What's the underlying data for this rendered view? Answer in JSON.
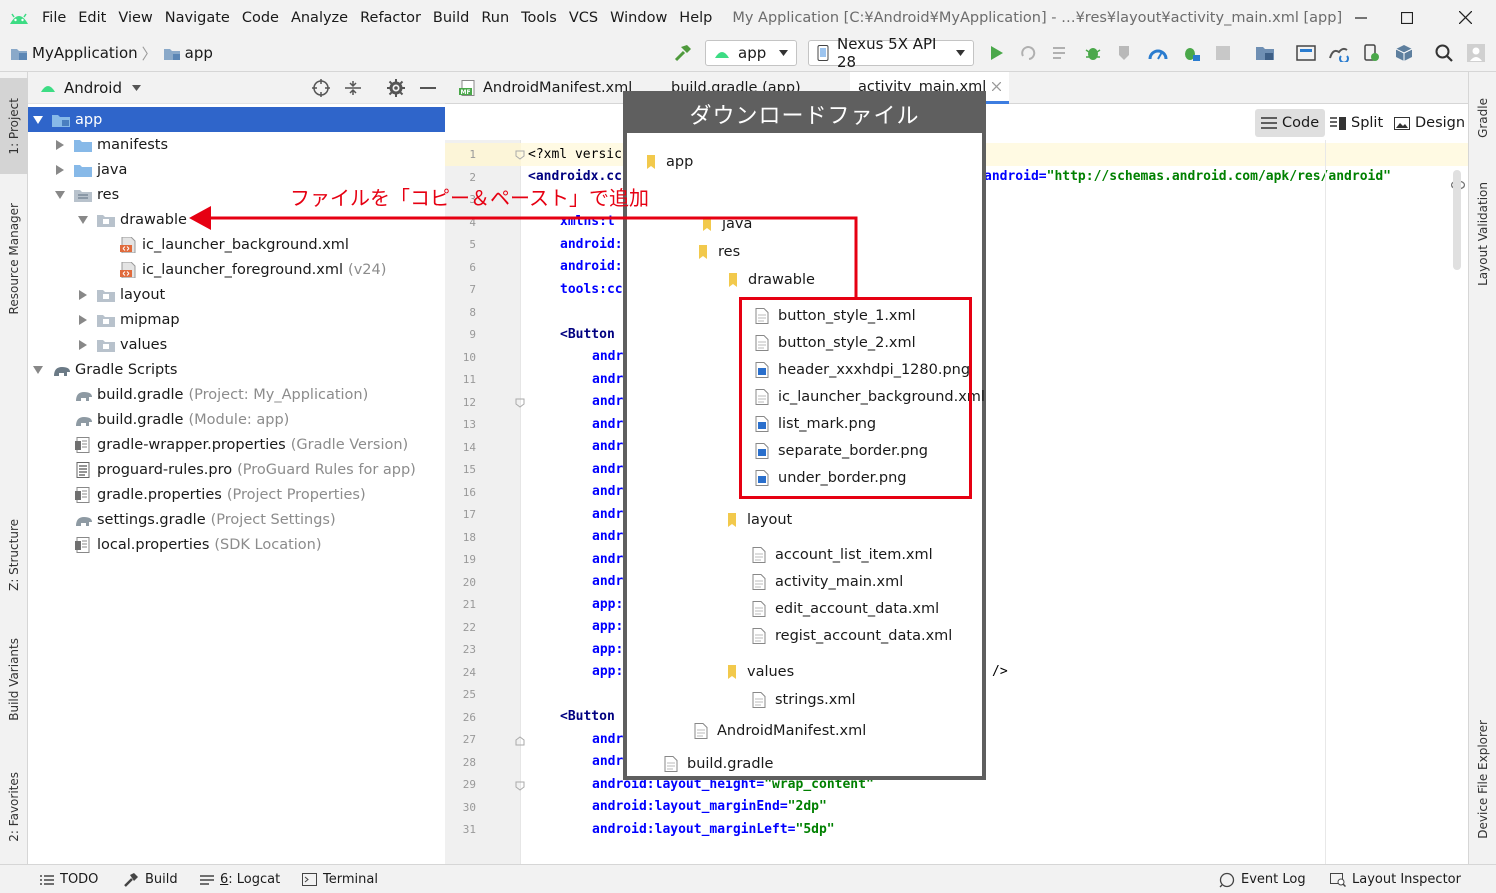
{
  "menu": {
    "items": [
      "File",
      "Edit",
      "View",
      "Navigate",
      "Code",
      "Analyze",
      "Refactor",
      "Build",
      "Run",
      "Tools",
      "VCS",
      "Window",
      "Help"
    ],
    "window_title": "My Application [C:¥Android¥MyApplication] - …¥res¥layout¥activity_main.xml [app]"
  },
  "navbar": {
    "project": "MyApplication",
    "module": "app",
    "run_config": "app",
    "device": "Nexus 5X API 28"
  },
  "left_stripe": [
    "1: Project",
    "Resource Manager",
    "Z: Structure",
    "Build Variants",
    "2: Favorites"
  ],
  "right_stripe": [
    "Gradle",
    "Layout Validation",
    "Device File Explorer"
  ],
  "project_panel": {
    "view": "Android",
    "tree": [
      {
        "label": "app",
        "hint": ""
      },
      {
        "label": "manifests",
        "hint": ""
      },
      {
        "label": "java",
        "hint": ""
      },
      {
        "label": "res",
        "hint": ""
      },
      {
        "label": "drawable",
        "hint": ""
      },
      {
        "label": "ic_launcher_background.xml",
        "hint": ""
      },
      {
        "label": "ic_launcher_foreground.xml",
        "hint": "(v24)"
      },
      {
        "label": "layout",
        "hint": ""
      },
      {
        "label": "mipmap",
        "hint": ""
      },
      {
        "label": "values",
        "hint": ""
      },
      {
        "label": "Gradle Scripts",
        "hint": ""
      },
      {
        "label": "build.gradle",
        "hint": "(Project: My_Application)"
      },
      {
        "label": "build.gradle",
        "hint": "(Module: app)"
      },
      {
        "label": "gradle-wrapper.properties",
        "hint": "(Gradle Version)"
      },
      {
        "label": "proguard-rules.pro",
        "hint": "(ProGuard Rules for app)"
      },
      {
        "label": "gradle.properties",
        "hint": "(Project Properties)"
      },
      {
        "label": "settings.gradle",
        "hint": "(Project Settings)"
      },
      {
        "label": "local.properties",
        "hint": "(SDK Location)"
      }
    ]
  },
  "editor": {
    "tabs": [
      "AndroidManifest.xml",
      "build.gradle (app)",
      "activity_main.xml"
    ],
    "modes": [
      "Code",
      "Split",
      "Design"
    ],
    "line_numbers": [
      "1",
      "2",
      "3",
      "4",
      "5",
      "6",
      "7",
      "8",
      "9",
      "10",
      "11",
      "12",
      "13",
      "14",
      "15",
      "16",
      "17",
      "18",
      "19",
      "20",
      "21",
      "22",
      "23",
      "24",
      "25",
      "26",
      "27",
      "28",
      "29",
      "30",
      "31"
    ],
    "code": {
      "l1": "<?xml versic",
      "l2": "<androidx.cc",
      "l2_attr": "android",
      "l2_eq": "=",
      "l2_val": "\"http://schemas.android.com/apk/res/android\"",
      "l4": "xmlns:t",
      "l5": "android:",
      "l6": "android:",
      "l7": "tools:cc",
      "l9": "<Button",
      "andr": "andr",
      "app": "app:",
      "l24_close": "/>",
      "l26": "<Button",
      "l29_attr": "android:layout_height",
      "l29_val": "\"wrap_content\"",
      "l30_attr": "android:layout_marginEnd",
      "l30_val": "\"2dp\"",
      "l31_attr": "android:layout_marginLeft",
      "l31_val": "\"5dp\"",
      "eq": "="
    }
  },
  "overlay": {
    "title": "ダウンロードファイル",
    "items": [
      {
        "type": "folder",
        "label": "app"
      },
      {
        "type": "folder",
        "label": "java"
      },
      {
        "type": "folder",
        "label": "res"
      },
      {
        "type": "folder",
        "label": "drawable"
      },
      {
        "type": "file",
        "label": "button_style_1.xml"
      },
      {
        "type": "file",
        "label": "button_style_2.xml"
      },
      {
        "type": "image",
        "label": "header_xxxhdpi_1280.png"
      },
      {
        "type": "file",
        "label": "ic_launcher_background.xml"
      },
      {
        "type": "image",
        "label": "list_mark.png"
      },
      {
        "type": "image",
        "label": "separate_border.png"
      },
      {
        "type": "image",
        "label": "under_border.png"
      },
      {
        "type": "folder",
        "label": "layout"
      },
      {
        "type": "file",
        "label": "account_list_item.xml"
      },
      {
        "type": "file",
        "label": "activity_main.xml"
      },
      {
        "type": "file",
        "label": "edit_account_data.xml"
      },
      {
        "type": "file",
        "label": "regist_account_data.xml"
      },
      {
        "type": "folder",
        "label": "values"
      },
      {
        "type": "file",
        "label": "strings.xml"
      },
      {
        "type": "file",
        "label": "AndroidManifest.xml"
      },
      {
        "type": "file",
        "label": "build.gradle"
      }
    ]
  },
  "annotation": {
    "text": "ファイルを「コピー＆ペースト」で追加",
    "color": "#e60012"
  },
  "statusbar": {
    "todo": "TODO",
    "build": "Build",
    "logcat_num": "6",
    "logcat": ": Logcat",
    "terminal": "Terminal",
    "event_log": "Event Log",
    "layout_inspector": "Layout Inspector"
  },
  "colors": {
    "accent": "#3d7de0",
    "selection": "#2f65ca",
    "android_green": "#3ddc84",
    "folder_blue": "#87b9e8",
    "annotation_red": "#e60012"
  }
}
